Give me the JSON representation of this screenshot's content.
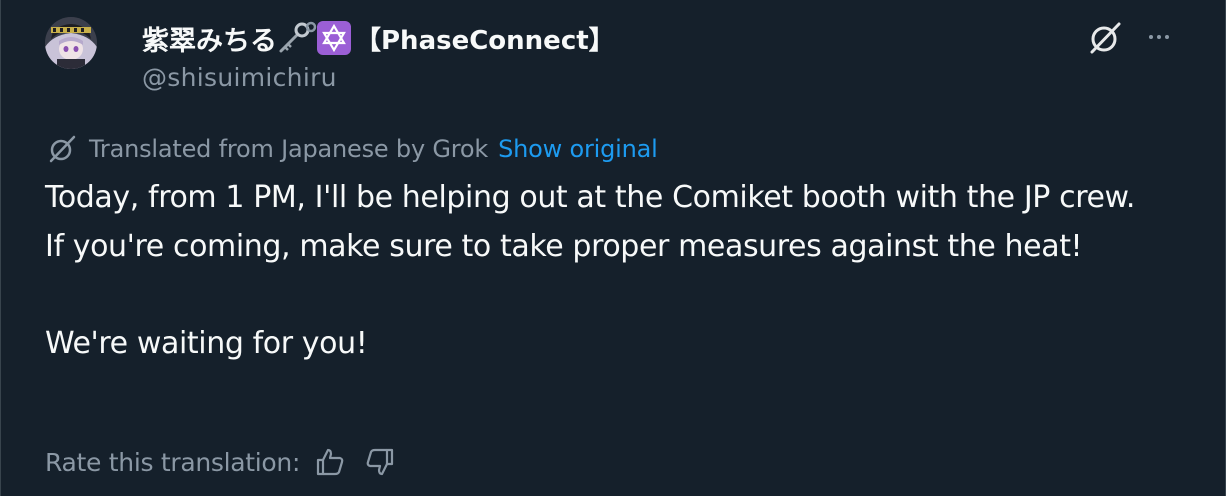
{
  "post": {
    "author": {
      "display_name": "紫翠みちる",
      "org": "【PhaseConnect】",
      "handle": "@shisuimichiru",
      "avatar_icon": "avatar-image",
      "name_emojis": [
        "key-icon",
        "star-of-david-badge-icon"
      ]
    },
    "header_actions": {
      "grok_icon": "grok-icon",
      "more_icon": "more-options-icon"
    },
    "translation": {
      "notice": "Translated from Japanese by Grok",
      "show_original": "Show original"
    },
    "body_lines": [
      "Today, from 1 PM, I'll be helping out at the Comiket booth with the JP crew.",
      "If you're coming, make sure to take proper measures against the heat!",
      "",
      "We're waiting for you!"
    ],
    "rate": {
      "label": "Rate this translation:",
      "up_icon": "thumbs-up-icon",
      "down_icon": "thumbs-down-icon"
    }
  },
  "colors": {
    "background": "#15202b",
    "text_primary": "#f7f9f9",
    "text_secondary": "#8b98a5",
    "link": "#1d9bf0",
    "badge_purple": "#9b5fd6"
  }
}
